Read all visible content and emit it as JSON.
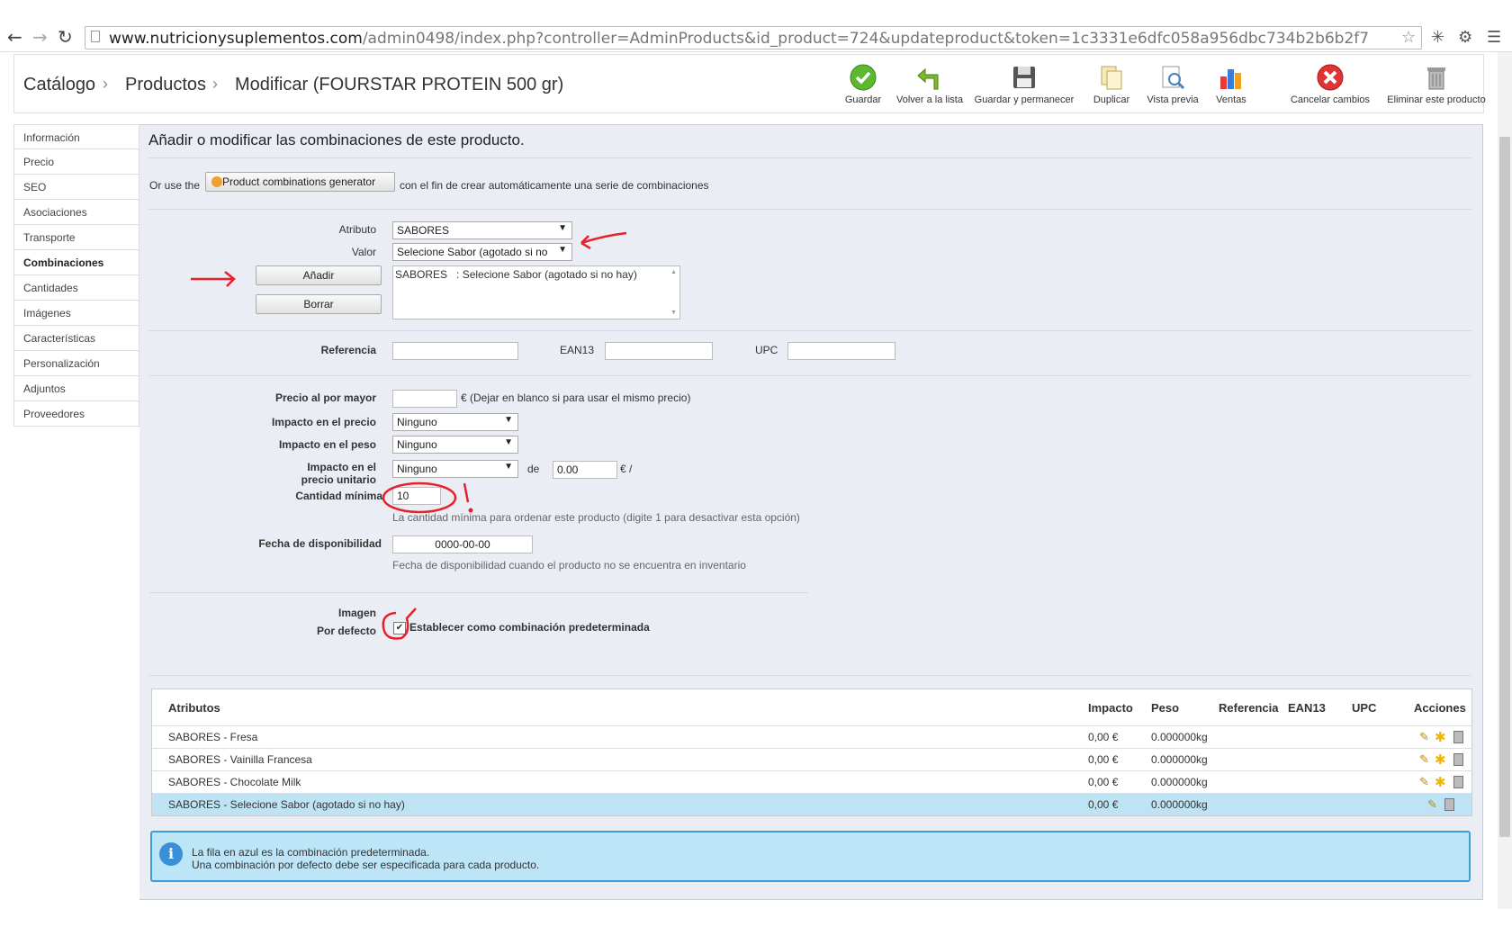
{
  "browser": {
    "url_domain": "www.nutricionysuplementos.com",
    "url_path": "/admin0498/index.php?controller=AdminProducts&id_product=724&updateproduct&token=1c3331e6dfc058a956dbc734b2b6b2f7"
  },
  "breadcrumb": {
    "level1": "Catálogo",
    "level2": "Productos",
    "level3": "Modificar (FOURSTAR PROTEIN 500 gr)"
  },
  "toolbar": {
    "save": "Guardar",
    "back": "Volver a la lista",
    "save_stay": "Guardar y permanecer",
    "duplicate": "Duplicar",
    "preview": "Vista previa",
    "sales": "Ventas",
    "cancel": "Cancelar cambios",
    "delete": "Eliminar este producto"
  },
  "sidebar": {
    "items": [
      {
        "label": "Información"
      },
      {
        "label": "Precio"
      },
      {
        "label": "SEO"
      },
      {
        "label": "Asociaciones"
      },
      {
        "label": "Transporte"
      },
      {
        "label": "Combinaciones"
      },
      {
        "label": "Cantidades"
      },
      {
        "label": "Imágenes"
      },
      {
        "label": "Características"
      },
      {
        "label": "Personalización"
      },
      {
        "label": "Adjuntos"
      },
      {
        "label": "Proveedores"
      }
    ],
    "active": "Combinaciones"
  },
  "form": {
    "heading": "Añadir o modificar las combinaciones de este producto.",
    "generator_prefix": "Or use the",
    "generator_button": "Product combinations generator",
    "generator_suffix": "con el fin de crear automáticamente una serie de combinaciones",
    "attribute_label": "Atributo",
    "attribute_value": "SABORES",
    "value_label": "Valor",
    "value_value": "Selecione Sabor (agotado si no",
    "add_button": "Añadir",
    "delete_button": "Borrar",
    "combination_list_item": "SABORES   : Selecione Sabor (agotado si no hay)",
    "reference_label": "Referencia",
    "ean13_label": "EAN13",
    "upc_label": "UPC",
    "wholesale_label": "Precio al por mayor",
    "wholesale_hint": "€ (Dejar en blanco si para usar el mismo precio)",
    "price_impact_label": "Impacto en el precio",
    "price_impact_value": "Ninguno",
    "weight_impact_label": "Impacto en el peso",
    "weight_impact_value": "Ninguno",
    "unit_impact_label_1": "Impacto en el",
    "unit_impact_label_2": "precio unitario",
    "unit_impact_value": "Ninguno",
    "unit_de": "de",
    "unit_amount": "0.00",
    "unit_suffix": "€ /",
    "min_qty_label": "Cantidad mínima",
    "min_qty_value": "10",
    "min_qty_hint": "La cantidad mínima para ordenar este producto (digite 1 para desactivar esta opción)",
    "availability_label": "Fecha de disponibilidad",
    "availability_value": "0000-00-00",
    "availability_hint": "Fecha de disponibilidad cuando el producto no se encuentra en inventario",
    "image_label": "Imagen",
    "default_label": "Por defecto",
    "default_checkbox_label": "Establecer como combinación predeterminada"
  },
  "table": {
    "headers": {
      "attributes": "Atributos",
      "impact": "Impacto",
      "weight": "Peso",
      "reference": "Referencia",
      "ean13": "EAN13",
      "upc": "UPC",
      "actions": "Acciones"
    },
    "rows": [
      {
        "attributes": "SABORES - Fresa",
        "impact": "0,00 €",
        "weight": "0.000000kg"
      },
      {
        "attributes": "SABORES - Vainilla Francesa",
        "impact": "0,00 €",
        "weight": "0.000000kg"
      },
      {
        "attributes": "SABORES - Chocolate Milk",
        "impact": "0,00 €",
        "weight": "0.000000kg"
      },
      {
        "attributes": "SABORES - Selecione Sabor (agotado si no hay)",
        "impact": "0,00 €",
        "weight": "0.000000kg"
      }
    ]
  },
  "info": {
    "line1": "La fila en azul es la combinación predeterminada.",
    "line2": "Una combinación por defecto debe ser especificada para cada producto."
  },
  "colors": {
    "default_row": "#bde3f4",
    "info_border": "#3aa0d4",
    "annotation": "#e8202a"
  }
}
